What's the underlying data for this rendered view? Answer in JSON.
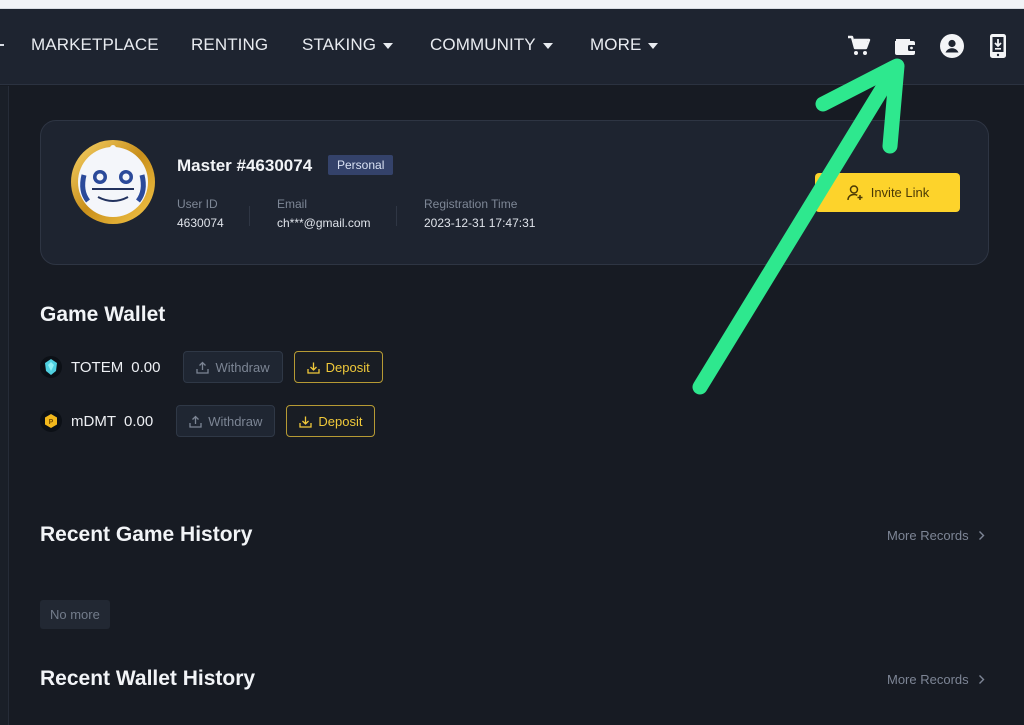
{
  "nav": {
    "items": [
      {
        "label": "MARKETPLACE",
        "has_dropdown": false
      },
      {
        "label": "RENTING",
        "has_dropdown": false
      },
      {
        "label": "STAKING",
        "has_dropdown": true
      },
      {
        "label": "COMMUNITY",
        "has_dropdown": true
      },
      {
        "label": "MORE",
        "has_dropdown": true
      }
    ],
    "icons": [
      "cart-icon",
      "wallet-icon",
      "account-icon",
      "app-download-icon"
    ]
  },
  "profile": {
    "name": "Master #4630074",
    "badge": "Personal",
    "fields": [
      {
        "label": "User ID",
        "value": "4630074"
      },
      {
        "label": "Email",
        "value": "ch***@gmail.com"
      },
      {
        "label": "Registration Time",
        "value": "2023-12-31 17:47:31"
      }
    ],
    "invite_label": "Invite Link"
  },
  "wallet": {
    "title": "Game Wallet",
    "tokens": [
      {
        "name": "TOTEM",
        "amount": "0.00",
        "withdraw_label": "Withdraw",
        "deposit_label": "Deposit"
      },
      {
        "name": "mDMT",
        "amount": "0.00",
        "withdraw_label": "Withdraw",
        "deposit_label": "Deposit"
      }
    ]
  },
  "game_history": {
    "title": "Recent Game History",
    "more_label": "More Records",
    "empty_label": "No more"
  },
  "wallet_history": {
    "title": "Recent Wallet History",
    "more_label": "More Records"
  },
  "colors": {
    "accent_yellow": "#fdd32b",
    "annotation_green": "#2ee88e",
    "badge_blue": "#34426a"
  }
}
